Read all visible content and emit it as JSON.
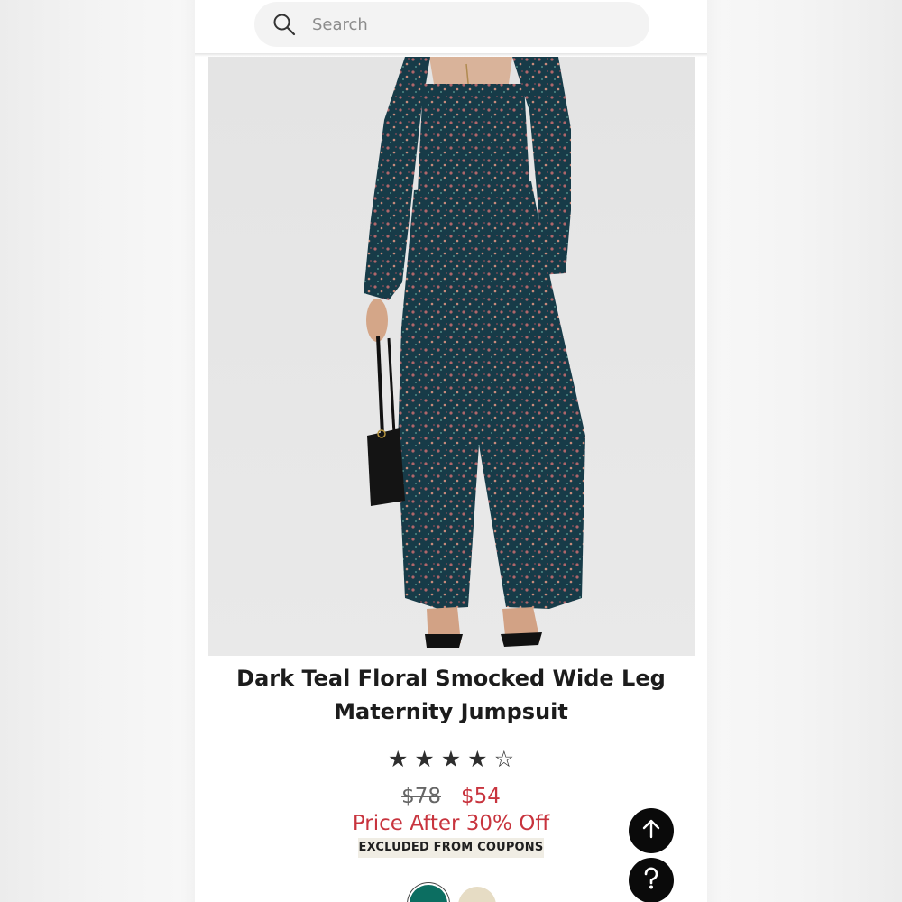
{
  "search": {
    "placeholder": "Search"
  },
  "product": {
    "image_alt": "Dark Teal Floral Smocked Wide Leg Maternity Jumpsuit",
    "title": "Dark Teal Floral Smocked Wide Leg Maternity Jumpsuit",
    "rating": 4,
    "rating_max": 5,
    "price_original": "$78",
    "price_sale": "$54",
    "price_note": "Price After 30% Off",
    "coupon_badge": "EXCLUDED FROM COUPONS",
    "swatches": [
      {
        "name": "dark-teal",
        "color": "#0c6e61",
        "selected": true
      },
      {
        "name": "cream",
        "color": "#e6dcc4",
        "selected": false
      }
    ]
  },
  "colors": {
    "sale_price": "#c8343e",
    "fab_background": "#0a0a0a",
    "badge_background": "#f0ede4"
  },
  "icons": {
    "search": "search-icon",
    "back_to_top": "arrow-up-icon",
    "help": "question-icon",
    "star_filled": "★",
    "star_empty": "☆"
  }
}
